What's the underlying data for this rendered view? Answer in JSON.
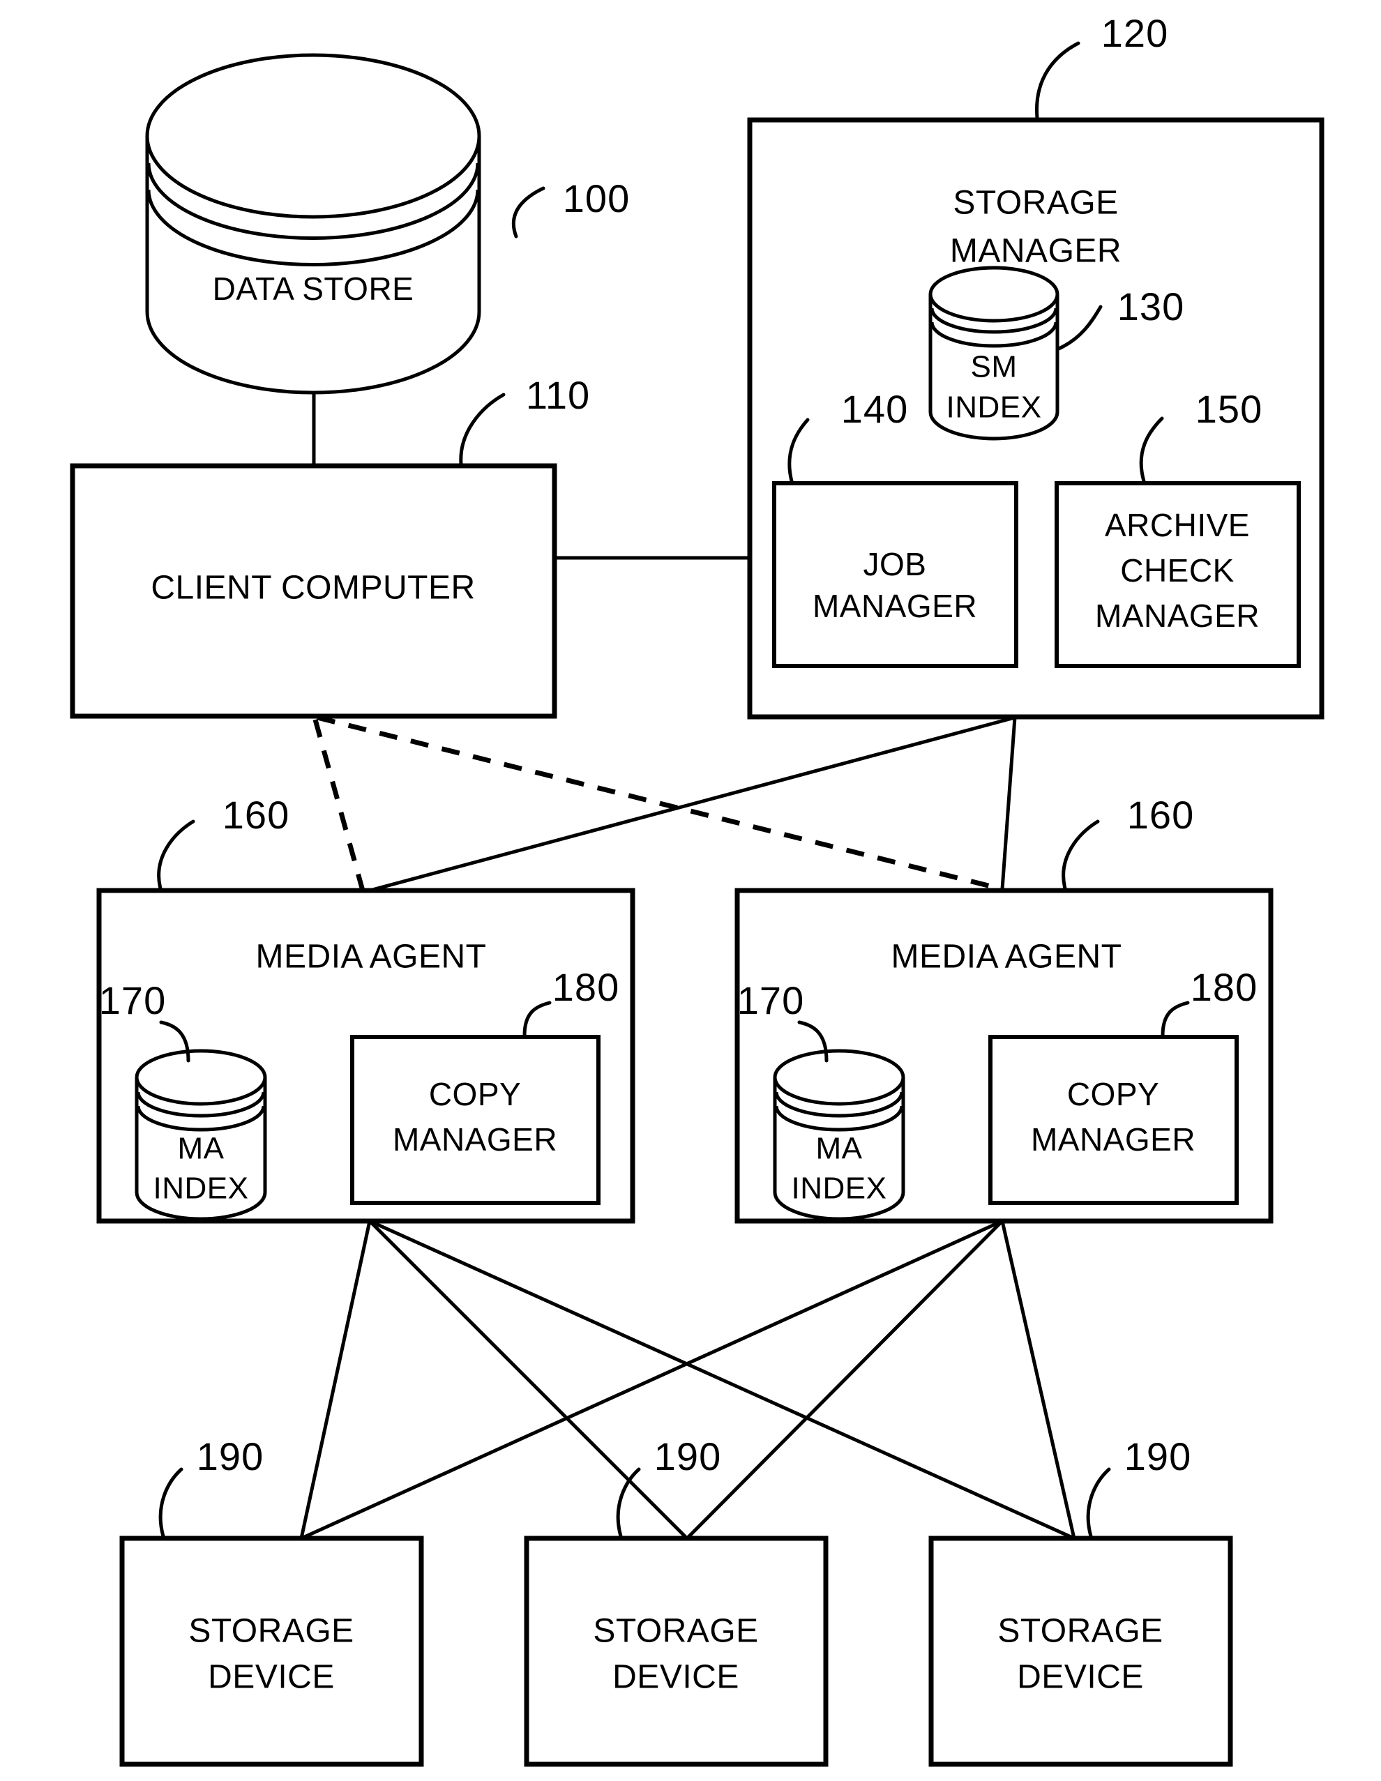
{
  "figure": {
    "type": "patent-block-diagram",
    "background_color": "#ffffff",
    "line_color": "#000000"
  },
  "nodes": {
    "data_store": {
      "label": "DATA STORE",
      "ref": "100",
      "shape": "cylinder"
    },
    "client_computer": {
      "label": "CLIENT COMPUTER",
      "ref": "110",
      "shape": "rectangle"
    },
    "storage_manager": {
      "label_line1": "STORAGE",
      "label_line2": "MANAGER",
      "ref": "120",
      "shape": "rectangle"
    },
    "sm_index": {
      "label_line1": "SM",
      "label_line2": "INDEX",
      "ref": "130",
      "shape": "cylinder"
    },
    "job_manager": {
      "label_line1": "JOB",
      "label_line2": "MANAGER",
      "ref": "140",
      "shape": "rectangle"
    },
    "archive_check_manager": {
      "label_line1": "ARCHIVE",
      "label_line2": "CHECK",
      "label_line3": "MANAGER",
      "ref": "150",
      "shape": "rectangle"
    },
    "media_agent_left": {
      "label": "MEDIA AGENT",
      "ref": "160",
      "shape": "rectangle"
    },
    "media_agent_right": {
      "label": "MEDIA AGENT",
      "ref": "160",
      "shape": "rectangle"
    },
    "ma_index_left": {
      "label_line1": "MA",
      "label_line2": "INDEX",
      "ref": "170",
      "shape": "cylinder"
    },
    "ma_index_right": {
      "label_line1": "MA",
      "label_line2": "INDEX",
      "ref": "170",
      "shape": "cylinder"
    },
    "copy_manager_left": {
      "label_line1": "COPY",
      "label_line2": "MANAGER",
      "ref": "180",
      "shape": "rectangle"
    },
    "copy_manager_right": {
      "label_line1": "COPY",
      "label_line2": "MANAGER",
      "ref": "180",
      "shape": "rectangle"
    },
    "storage_device_1": {
      "label_line1": "STORAGE",
      "label_line2": "DEVICE",
      "ref": "190",
      "shape": "rectangle"
    },
    "storage_device_2": {
      "label_line1": "STORAGE",
      "label_line2": "DEVICE",
      "ref": "190",
      "shape": "rectangle"
    },
    "storage_device_3": {
      "label_line1": "STORAGE",
      "label_line2": "DEVICE",
      "ref": "190",
      "shape": "rectangle"
    }
  },
  "connections": [
    {
      "from": "data_store",
      "to": "client_computer",
      "style": "solid"
    },
    {
      "from": "client_computer",
      "to": "storage_manager",
      "style": "solid"
    },
    {
      "from": "client_computer",
      "to": "media_agent_right",
      "style": "dashed"
    },
    {
      "from": "client_computer",
      "to": "media_agent_left",
      "style": "dashed"
    },
    {
      "from": "storage_manager",
      "to": "media_agent_left",
      "style": "solid"
    },
    {
      "from": "storage_manager",
      "to": "media_agent_right",
      "style": "solid"
    },
    {
      "from": "media_agent_left",
      "to": "storage_device_1",
      "style": "solid"
    },
    {
      "from": "media_agent_left",
      "to": "storage_device_2",
      "style": "solid"
    },
    {
      "from": "media_agent_left",
      "to": "storage_device_3",
      "style": "solid"
    },
    {
      "from": "media_agent_right",
      "to": "storage_device_1",
      "style": "solid"
    },
    {
      "from": "media_agent_right",
      "to": "storage_device_2",
      "style": "solid"
    },
    {
      "from": "media_agent_right",
      "to": "storage_device_3",
      "style": "solid"
    }
  ]
}
